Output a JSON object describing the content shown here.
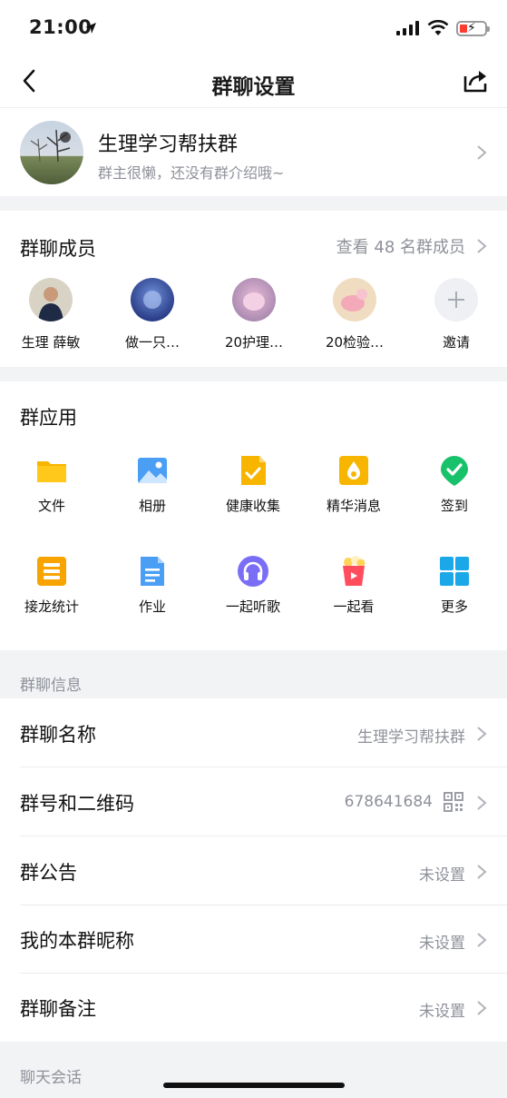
{
  "status": {
    "time": "21:00"
  },
  "nav": {
    "title": "群聊设置"
  },
  "group": {
    "name": "生理学习帮扶群",
    "intro": "群主很懒，还没有群介绍哦~"
  },
  "members": {
    "title": "群聊成员",
    "view_all": "查看 48 名群成员",
    "list": [
      {
        "name": "生理 薛敏"
      },
      {
        "name": "做一只…"
      },
      {
        "name": "20护理…"
      },
      {
        "name": "20检验…"
      },
      {
        "name": "邀请"
      }
    ]
  },
  "apps": {
    "title": "群应用",
    "items": [
      {
        "label": "文件",
        "icon": "folder-icon",
        "color": "#f7b500"
      },
      {
        "label": "相册",
        "icon": "photo-icon",
        "color": "#4a9ff5"
      },
      {
        "label": "健康收集",
        "icon": "health-form-icon",
        "color": "#f7b500"
      },
      {
        "label": "精华消息",
        "icon": "essence-icon",
        "color": "#f7b500"
      },
      {
        "label": "签到",
        "icon": "checkin-icon",
        "color": "#17c26b"
      },
      {
        "label": "接龙统计",
        "icon": "relay-list-icon",
        "color": "#f7a400"
      },
      {
        "label": "作业",
        "icon": "homework-icon",
        "color": "#4a9ff5"
      },
      {
        "label": "一起听歌",
        "icon": "headphones-icon",
        "color": "#7b6ef6"
      },
      {
        "label": "一起看",
        "icon": "popcorn-icon",
        "color": "#ff4d5e"
      },
      {
        "label": "更多",
        "icon": "grid-more-icon",
        "color": "#1ba8e8"
      }
    ]
  },
  "info": {
    "header": "群聊信息",
    "rows": [
      {
        "label": "群聊名称",
        "value": "生理学习帮扶群"
      },
      {
        "label": "群号和二维码",
        "value": "678641684"
      },
      {
        "label": "群公告",
        "value": "未设置"
      },
      {
        "label": "我的本群昵称",
        "value": "未设置"
      },
      {
        "label": "群聊备注",
        "value": "未设置"
      }
    ]
  },
  "chat": {
    "header": "聊天会话"
  }
}
